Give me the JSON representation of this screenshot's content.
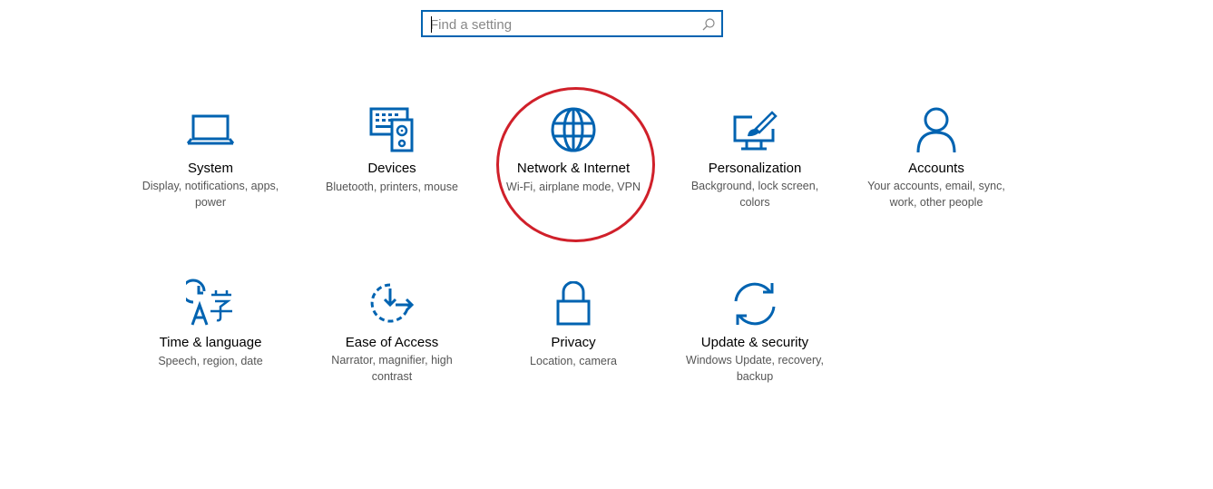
{
  "search": {
    "placeholder": "Find a setting",
    "value": ""
  },
  "accent_color": "#0063b1",
  "annotation_color": "#d0202a",
  "tiles": [
    {
      "icon": "laptop-icon",
      "title": "System",
      "desc": "Display, notifications, apps, power"
    },
    {
      "icon": "keyboard-speaker-icon",
      "title": "Devices",
      "desc": "Bluetooth, printers, mouse"
    },
    {
      "icon": "globe-icon",
      "title": "Network & Internet",
      "desc": "Wi-Fi, airplane mode, VPN"
    },
    {
      "icon": "paintbrush-monitor-icon",
      "title": "Personalization",
      "desc": "Background, lock screen, colors"
    },
    {
      "icon": "person-icon",
      "title": "Accounts",
      "desc": "Your accounts, email, sync, work, other people"
    },
    {
      "icon": "clock-language-icon",
      "title": "Time & language",
      "desc": "Speech, region, date"
    },
    {
      "icon": "ease-of-access-icon",
      "title": "Ease of Access",
      "desc": "Narrator, magnifier, high contrast"
    },
    {
      "icon": "lock-icon",
      "title": "Privacy",
      "desc": "Location, camera"
    },
    {
      "icon": "sync-arrows-icon",
      "title": "Update & security",
      "desc": "Windows Update, recovery, backup"
    }
  ]
}
